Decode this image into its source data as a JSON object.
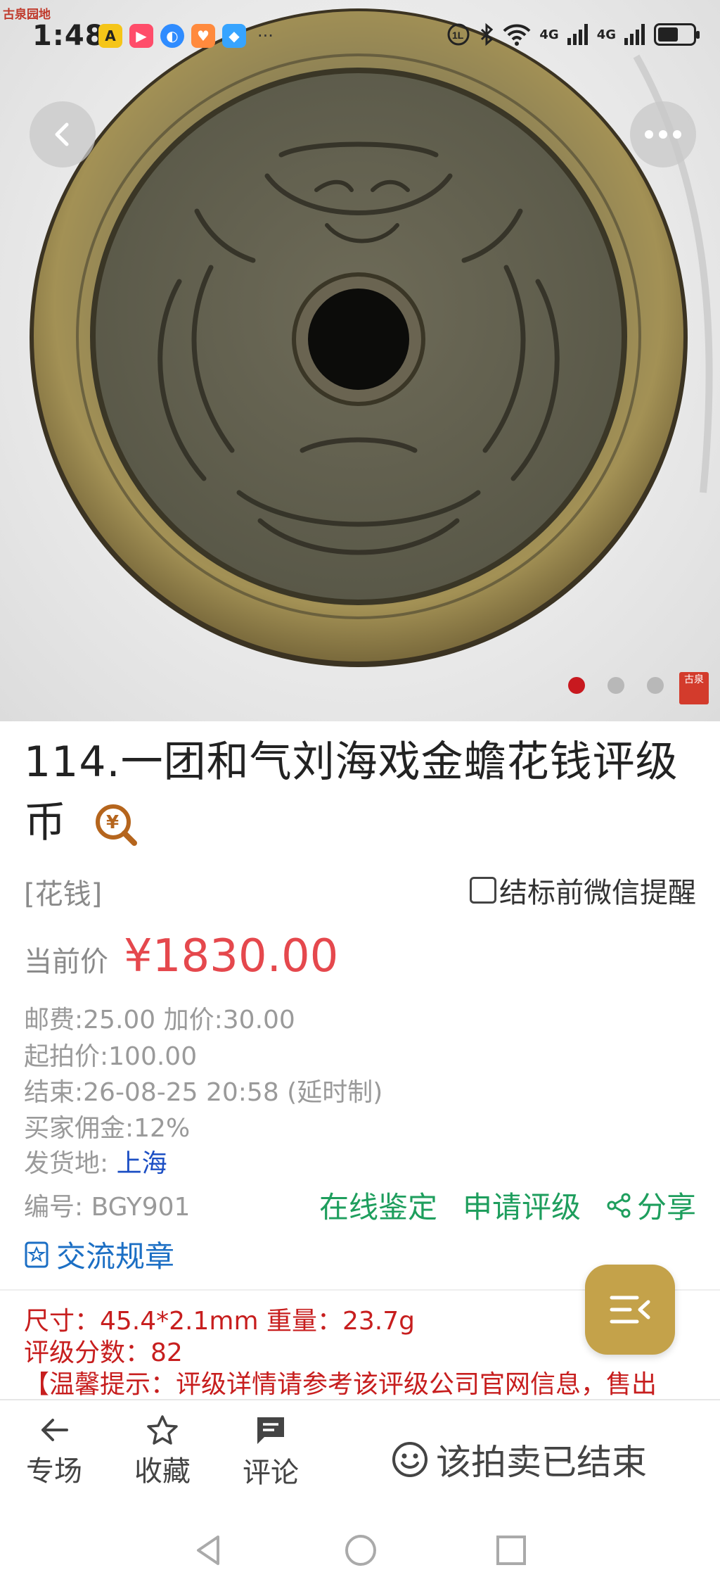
{
  "status_bar": {
    "watermark": "古泉园地",
    "time": "1:48",
    "more": "···",
    "signal_1": "4G",
    "signal_2": "4G"
  },
  "gallery": {
    "pages": 4,
    "active_page": 1,
    "seal_text": "古泉"
  },
  "item": {
    "title": "114.一团和气刘海戏金蟾花钱评级币",
    "category": "[花钱]",
    "remind_label": "结标前微信提醒",
    "price_label": "当前价",
    "price": "¥1830.00",
    "fee_line": "邮费:25.00  加价:30.00",
    "start_price": "起拍价:100.00",
    "end_time": "结束:26-08-25 20:58 (延时制)",
    "commission": "买家佣金:12%",
    "ship_label": "发货地: ",
    "ship_from": "上海",
    "item_no": "编号: BGY901"
  },
  "actions": {
    "appraise": "在线鉴定",
    "grading": "申请评级",
    "share": "分享",
    "rules": "交流规章"
  },
  "description": {
    "size_line": "尺寸：45.4*2.1mm 重量：23.7g",
    "grade_line": "评级分数：82",
    "notice_line": "【温馨提示：评级详情请参考该评级公司官网信息，售出"
  },
  "bottom_bar": {
    "venue": "专场",
    "favorite": "收藏",
    "comment": "评论",
    "ended": "该拍卖已结束"
  },
  "colors": {
    "price": "#e5484d",
    "green": "#1e9e5d",
    "blue": "#1c4fc4",
    "desc_red": "#c71e1e",
    "fab_gold": "#c4a24a"
  }
}
